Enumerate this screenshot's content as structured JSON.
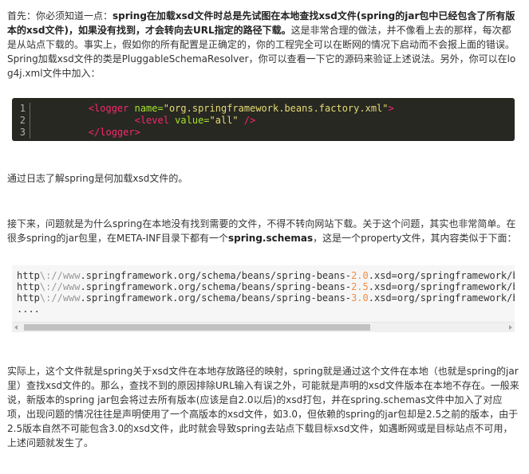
{
  "intro": {
    "p1": "首先：你必须知道一点：",
    "b1": "spring在加载xsd文件时总是先试图在本地查找xsd文件(spring的jar包中已经包含了所有版本的xsd文件)，如果没有找到，才会转向去URL指定的路径下载。",
    "p2": "这是非常合理的做法，并不像看上去的那样，每次都是从站点下载的。事实上，假如你的所有配置是正确定的，你的工程完全可以在断网的情况下启动而不会报上面的错误。Spring加载xsd文件的类是PluggableSchemaResolver，你可以查看一下它的源码来验证上述说法。另外，你可以在log4j.xml文件中加入："
  },
  "code1": {
    "line_numbers": [
      "1",
      "2",
      "3"
    ],
    "line1_open": "<logger",
    "line1_attr": " name=",
    "line1_val": "\"org.springframework.beans.factory.xml\"",
    "line1_close": ">",
    "line2_open": "<level",
    "line2_attr": " value=",
    "line2_val": "\"all\"",
    "line2_close": " />",
    "line3": "</logger>"
  },
  "mid": {
    "p_log": "通过日志了解spring是何加载xsd文件的。",
    "p_next1": "接下来，问题就是为什么spring在本地没有找到需要的文件，不得不转向网站下载。关于这个问题，其实也非常简单。在很多spring的jar包里，在META-INF目录下都有一个",
    "p_next_b": "spring.schemas",
    "p_next2": "，这是一个property文件，其内容类似于下面："
  },
  "code2": {
    "prefix": "http",
    "sep": "\\://",
    "www": "www",
    "path_a": ".springframework.org/schema/beans/spring-beans-",
    "v1": "2.0",
    "v2": "2.5",
    "v3": "3.0",
    "path_b": ".xsd=org/springframework/b",
    "dots": "...."
  },
  "outro": {
    "p_final": "实际上，这个文件就是spring关于xsd文件在本地存放路径的映射，spring就是通过这个文件在本地（也就是spring的jar里）查找xsd文件的。那么，查找不到的原因排除URL输入有误之外，可能就是声明的xsd文件版本在本地不存在。一般来说，新版本的spring jar包会将过去所有版本(应该是自2.0以后)的xsd打包，并在spring.schemas文件中加入了对应项，出现问题的情况往往是声明使用了一个高版本的xsd文件，如3.0，但依赖的spring的jar包却是2.5之前的版本，由于2.5版本自然不可能包含3.0的xsd文件，此时就会导致spring去站点下载目标xsd文件，如遇断网或是目标站点不可用，上述问题就发生了。"
  }
}
